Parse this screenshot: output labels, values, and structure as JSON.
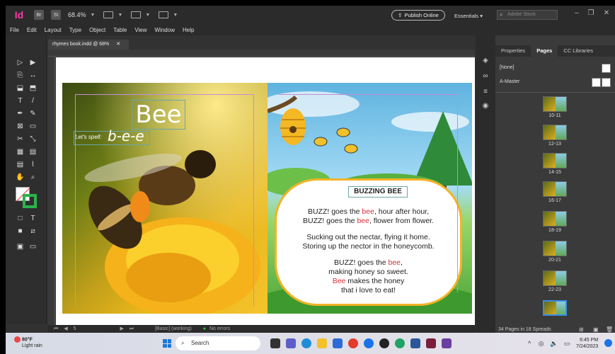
{
  "app": {
    "logo": "Id",
    "chips": [
      "Br",
      "St"
    ],
    "zoom": "68.4%",
    "publish_label": "Publish Online",
    "workspace": "Essentials",
    "stock_placeholder": "Adobe Stock"
  },
  "menubar": [
    "File",
    "Edit",
    "Layout",
    "Type",
    "Object",
    "Table",
    "View",
    "Window",
    "Help"
  ],
  "document": {
    "tab_title": "rhymes book.indd @ 68%",
    "status": "[Basic] (working)",
    "page_field": "5",
    "errors": "No errors"
  },
  "left_page": {
    "title": "Bee",
    "lets_spell": "Let's spell:",
    "spelling": "b-e-e"
  },
  "right_page": {
    "title": "BUZZING BEE",
    "stanza1": [
      [
        {
          "t": "BUZZ! goes the "
        },
        {
          "t": "bee",
          "red": true
        },
        {
          "t": ", hour after hour,"
        }
      ],
      [
        {
          "t": "BUZZ! goes the "
        },
        {
          "t": "bee",
          "red": true
        },
        {
          "t": ", flower from flower."
        }
      ]
    ],
    "stanza2": [
      [
        {
          "t": "Sucking out the nectar, flying it home."
        }
      ],
      [
        {
          "t": "Storing up the nector in the honeycomb."
        }
      ]
    ],
    "stanza3": [
      [
        {
          "t": "BUZZ! goes the "
        },
        {
          "t": "bee",
          "red": true
        },
        {
          "t": ","
        }
      ],
      [
        {
          "t": "making honey so sweet."
        }
      ],
      [
        {
          "t": "Bee",
          "red": true
        },
        {
          "t": " makes the honey"
        }
      ],
      [
        {
          "t": "that i love to eat!"
        }
      ]
    ]
  },
  "panel": {
    "tabs": [
      "Properties",
      "Pages",
      "CC Libraries"
    ],
    "active_tab": "Pages",
    "masters": [
      "[None]",
      "A-Master"
    ],
    "spreads": [
      "10-11",
      "12-13",
      "14-15",
      "16-17",
      "18-19",
      "20-21",
      "22-23"
    ],
    "pages_summary": "34 Pages in 18 Spreads"
  },
  "taskbar": {
    "temperature": "80°F",
    "weather": "Light rain",
    "search": "Search",
    "time": "6:45 PM",
    "date": "7/24/2023"
  },
  "colors": {
    "accent_red": "#d6303a",
    "cloud_border": "#f3b325",
    "guide": "#c58cd6",
    "frame_edge": "#6ca6a8"
  }
}
